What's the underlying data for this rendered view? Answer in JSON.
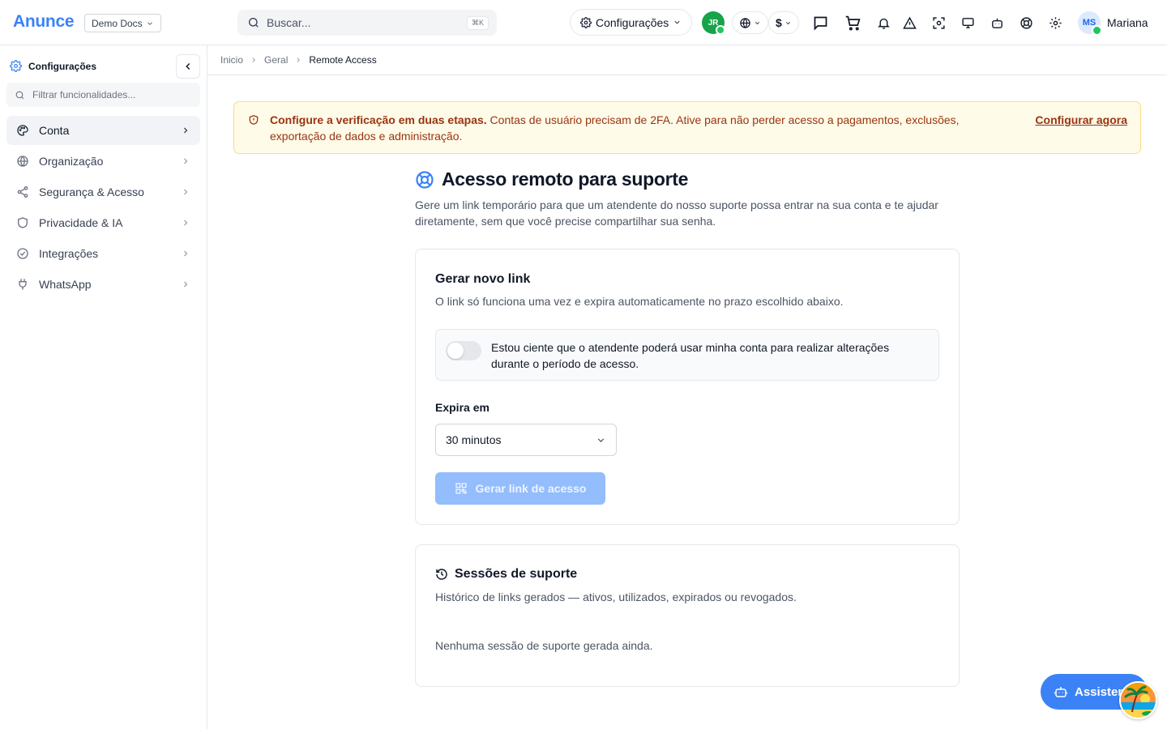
{
  "app": {
    "logo": "Anunce",
    "org_select": "Demo Docs",
    "search_placeholder": "Buscar...",
    "search_shortcut": "⌘K",
    "settings_label": "Configurações",
    "org_avatar_initials": "JR",
    "currency_symbol": "$",
    "user_initials": "MS",
    "user_name": "Mariana",
    "brand_color": "#3b82f6"
  },
  "sidebar": {
    "title": "Configurações",
    "filter_placeholder": "Filtrar funcionalidades...",
    "items": [
      {
        "label": "Conta",
        "icon": "palette-icon",
        "active": true
      },
      {
        "label": "Organização",
        "icon": "globe-icon"
      },
      {
        "label": "Segurança & Acesso",
        "icon": "share-icon"
      },
      {
        "label": "Privacidade & IA",
        "icon": "shield-icon"
      },
      {
        "label": "Integrações",
        "icon": "check-circle-icon"
      },
      {
        "label": "WhatsApp",
        "icon": "plug-icon"
      }
    ]
  },
  "breadcrumbs": [
    "Inicio",
    "Geral",
    "Remote Access"
  ],
  "alert": {
    "title": "Configure a verificação em duas etapas.",
    "message": "Contas de usuário precisam de 2FA. Ative para não perder acesso a pagamentos, exclusões, exportação de dados e administração.",
    "action": "Configurar agora",
    "color": "#fefbe8"
  },
  "page": {
    "title": "Acesso remoto para suporte",
    "description": "Gere um link temporário para que um atendente do nosso suporte possa entrar na sua conta e te ajudar diretamente, sem que você precise compartilhar sua senha."
  },
  "generate": {
    "title": "Gerar novo link",
    "subtitle": "O link só funciona uma vez e expira automaticamente no prazo escolhido abaixo.",
    "consent_text": "Estou ciente que o atendente poderá usar minha conta para realizar alterações durante o período de acesso.",
    "consent_checked": false,
    "expires_label": "Expira em",
    "expires_value": "30 minutos",
    "button_label": "Gerar link de acesso"
  },
  "sessions": {
    "title": "Sessões de suporte",
    "subtitle": "Histórico de links gerados — ativos, utilizados, expirados ou revogados.",
    "empty": "Nenhuma sessão de suporte gerada ainda."
  },
  "assistant": {
    "label": "Assistente"
  }
}
